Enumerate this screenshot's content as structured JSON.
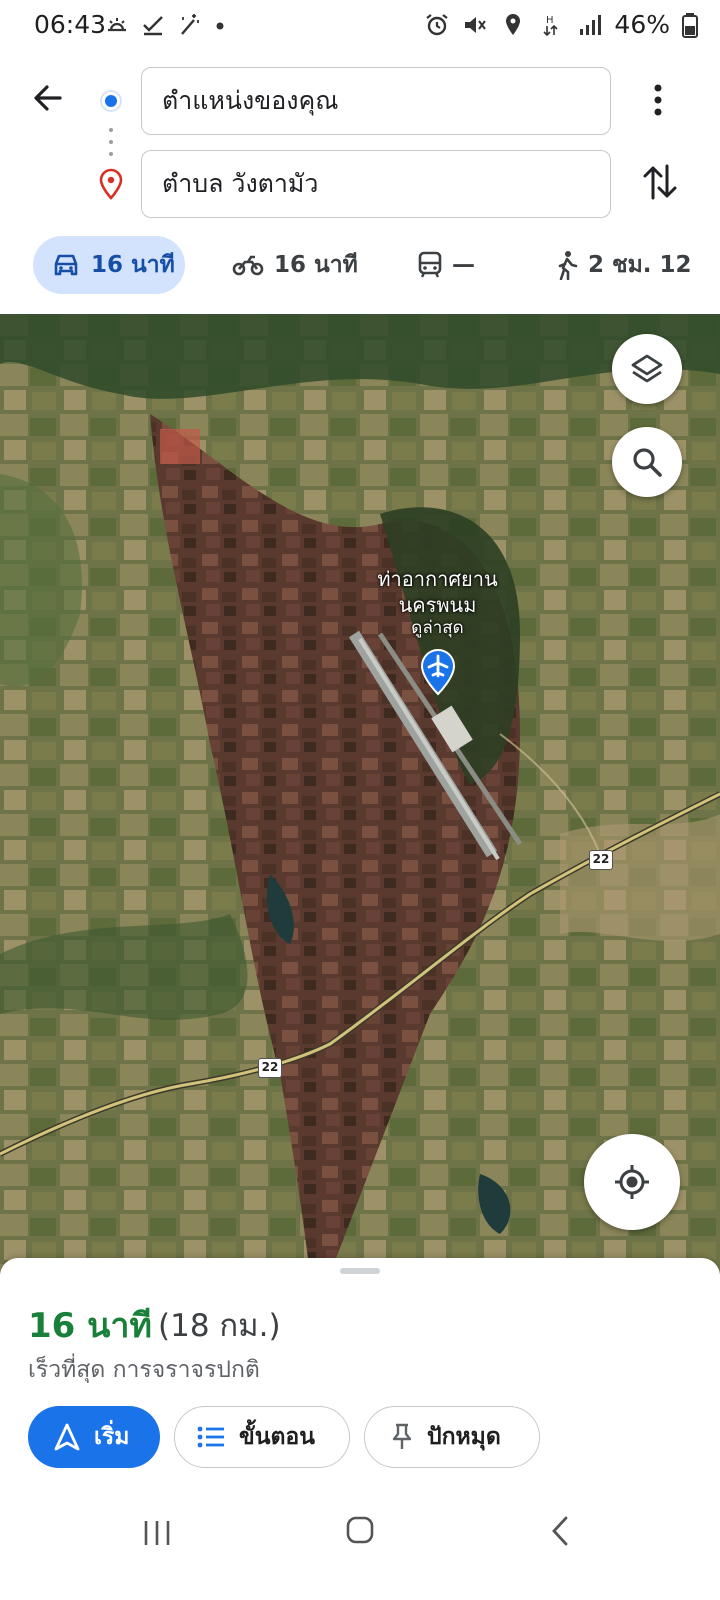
{
  "status_bar": {
    "time": "06:43",
    "battery": "46%",
    "left_icons": [
      "weather-icon",
      "check-icon",
      "magic-icon",
      "dot-icon"
    ],
    "right_icons": [
      "alarm-icon",
      "mute-icon",
      "location-icon",
      "data-icon",
      "signal-icon",
      "battery-icon"
    ]
  },
  "header": {
    "origin": "ตำแหน่งของคุณ",
    "destination": "ตำบล วังตามัว"
  },
  "travel_modes": [
    {
      "mode": "car",
      "label": "16 นาที",
      "selected": true
    },
    {
      "mode": "motorcycle",
      "label": "16 นาที",
      "selected": false
    },
    {
      "mode": "transit",
      "label": "—",
      "selected": false
    },
    {
      "mode": "walk",
      "label": "2 ชม. 12",
      "selected": false
    }
  ],
  "map": {
    "poi_name": "ท่าอากาศยานนครพนม",
    "poi_name_line1": "ท่าอากาศยาน",
    "poi_name_line2": "นครพนม",
    "poi_subtitle": "ดูล่าสุด",
    "road_shield_1": "22",
    "road_shield_2": "22"
  },
  "route": {
    "duration": "16 นาที",
    "distance": "(18 กม.)",
    "description": "เร็วที่สุด การจราจรปกติ"
  },
  "actions": {
    "start": "เริ่ม",
    "steps": "ขั้นตอน",
    "pin": "ปักหมุด"
  },
  "colors": {
    "accent": "#1a73e8",
    "duration_green": "#188038",
    "selected_mode_bg": "#d3e3fd"
  }
}
